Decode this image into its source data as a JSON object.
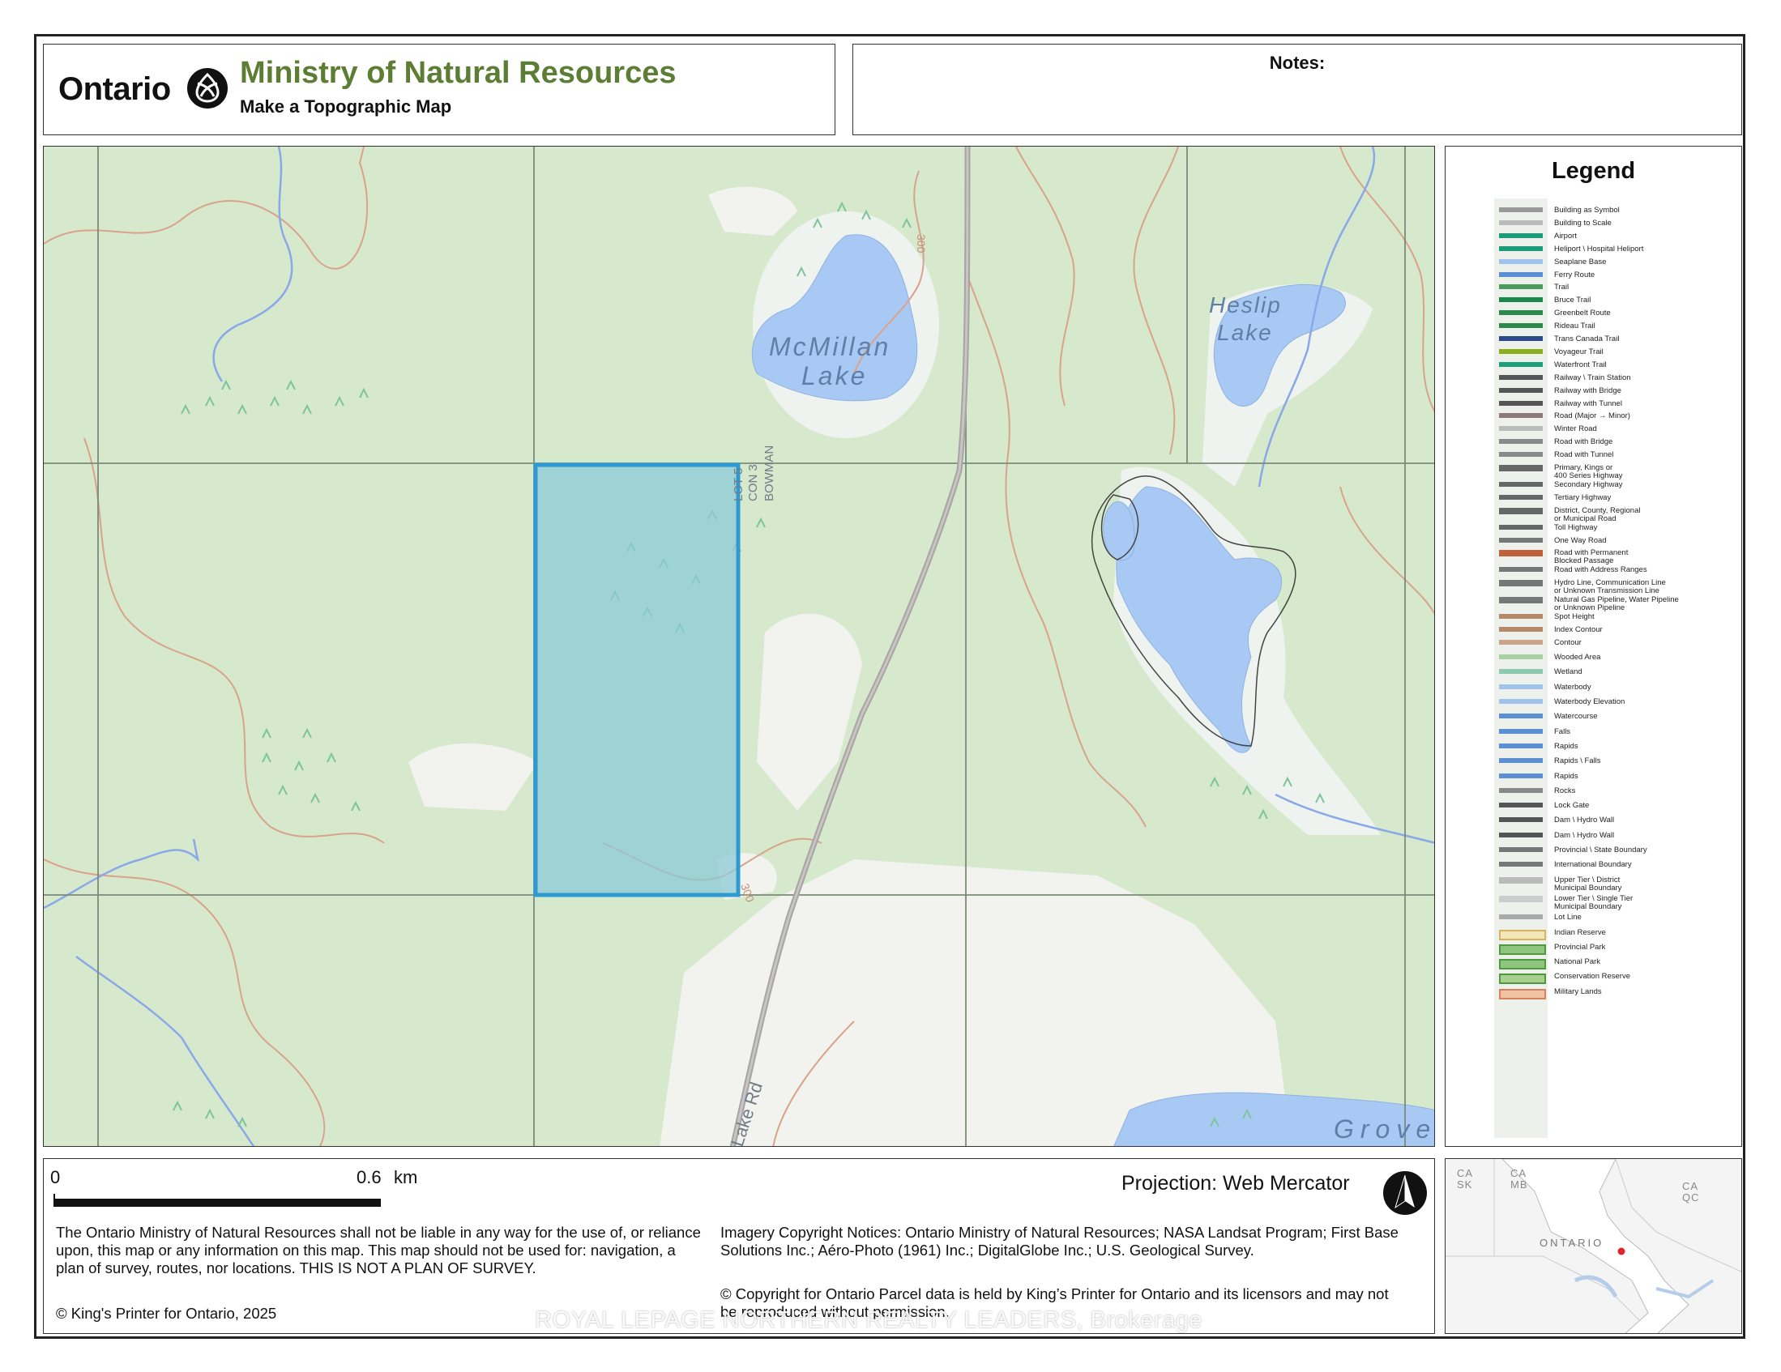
{
  "header": {
    "ontario_wordmark": "Ontario",
    "logo_icon": "ontario-trillium-logo",
    "ministry": "Ministry of Natural Resources",
    "subtitle": "Make a Topographic Map"
  },
  "notes": {
    "label": "Notes:"
  },
  "map": {
    "labels": {
      "mcmillan_1": "McMillan",
      "mcmillan_2": "Lake",
      "heslip_1": "Heslip",
      "heslip_2": "Lake",
      "grove": "Grove",
      "road": "Lake Rd",
      "lot": "LOT 5",
      "con": "CON 3",
      "twp": "BOWMAN",
      "contour_top": "300",
      "contour_bottom": "300"
    },
    "colors": {
      "land": "#d6e9cd",
      "clearing": "#f2f2ee",
      "water": "#a9c9f5",
      "parcel_fill": "#8cc9d6",
      "parcel_outline": "#2e9ad4",
      "contour": "#d9a38b",
      "road": "#a9a4a4",
      "lot_line": "#7d8a7a"
    }
  },
  "legend": {
    "title": "Legend",
    "items": [
      "Building as Symbol",
      "Building to Scale",
      "Airport",
      "Heliport \\ Hospital Heliport",
      "Seaplane Base",
      "Ferry Route",
      "Trail",
      "Bruce Trail",
      "Greenbelt Route",
      "Rideau Trail",
      "Trans Canada Trail",
      "Voyageur Trail",
      "Waterfront Trail",
      "Railway \\ Train Station",
      "Railway with Bridge",
      "Railway with Tunnel",
      "Road (Major → Minor)",
      "Winter Road",
      "Road with Bridge",
      "Road with Tunnel",
      "Primary, Kings or\n400 Series Highway",
      "Secondary Highway",
      "Tertiary Highway",
      "District, County, Regional\nor Municipal Road",
      "Toll Highway",
      "One Way Road",
      "Road with Permanent\nBlocked Passage",
      "Road with Address Ranges",
      "Hydro Line, Communication Line\nor Unknown Transmission Line",
      "Natural Gas Pipeline, Water Pipeline\nor Unknown Pipeline",
      "Spot Height",
      "Index Contour",
      "Contour",
      "Wooded Area",
      "Wetland",
      "Waterbody",
      "Waterbody Elevation",
      "Watercourse",
      "Falls",
      "Rapids",
      "Rapids \\ Falls",
      "Rapids",
      "Rocks",
      "Lock Gate",
      "Dam \\ Hydro Wall",
      "Dam \\ Hydro Wall",
      "Provincial \\ State Boundary",
      "International Boundary",
      "Upper Tier \\ District\nMunicipal Boundary",
      "Lower Tier \\ Single Tier\nMunicipal Boundary",
      "Lot Line",
      "Indian Reserve",
      "Provincial Park",
      "National Park",
      "Conservation Reserve",
      "Military Lands"
    ]
  },
  "scale": {
    "start": "0",
    "end": "0.6",
    "unit": "km"
  },
  "projection": "Projection: Web Mercator",
  "north_arrow_icon": "north-arrow-icon",
  "disclaimer": "The Ontario Ministry of Natural Resources shall not be liable in any way for the use of, or reliance upon, this map or any information on this map.  This map should not be used for: navigation, a plan of survey, routes, nor locations. THIS IS NOT A PLAN OF SURVEY.",
  "imagery": "Imagery Copyright Notices: Ontario Ministry of Natural Resources; NASA Landsat Program; First Base Solutions Inc.; Aéro-Photo (1961) Inc.; DigitalGlobe Inc.; U.S. Geological Survey.",
  "parcel_copyright": "© Copyright for Ontario Parcel data is held by King’s Printer for Ontario and its licensors and may not be reproduced without permission.",
  "copyright": "© King's Printer for Ontario,  2025",
  "watermark": "ROYAL LEPAGE NORTHERN REALTY LEADERS, Brokerage",
  "inset": {
    "labels": {
      "ca_sk_1": "CA",
      "ca_sk_2": "SK",
      "ca_mb_1": "CA",
      "ca_mb_2": "MB",
      "ca_qc_1": "CA",
      "ca_qc_2": "QC",
      "ontario": "ONTARIO"
    }
  }
}
